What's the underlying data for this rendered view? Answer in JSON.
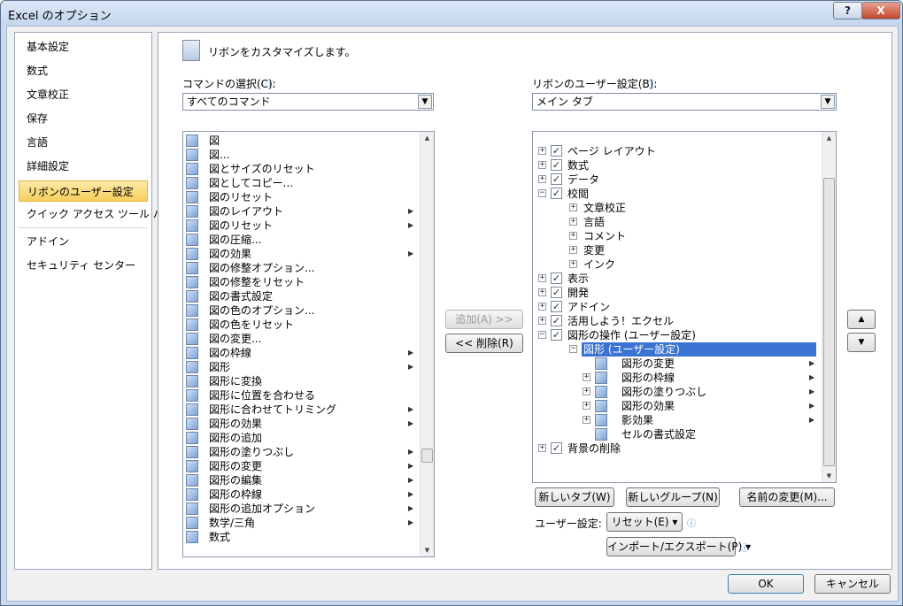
{
  "window": {
    "title": "Excel のオプション",
    "help": "?",
    "close": "X"
  },
  "nav": {
    "items": [
      "基本設定",
      "数式",
      "文章校正",
      "保存",
      "言語",
      "詳細設定",
      "リボンのユーザー設定",
      "クイック アクセス ツール バー",
      "アドイン",
      "セキュリティ センター"
    ],
    "selected_index": 6
  },
  "main": {
    "heading": "リボンをカスタマイズします。",
    "commands_label": "コマンドの選択(C):",
    "commands_value": "すべてのコマンド",
    "ribbon_label": "リボンのユーザー設定(B):",
    "ribbon_value": "メイン タブ",
    "add_button": "追加(A) >>",
    "remove_button": "<< 削除(R)",
    "new_tab": "新しいタブ(W)",
    "new_group": "新しいグループ(N)",
    "rename": "名前の変更(M)...",
    "user_settings_label": "ユーザー設定:",
    "reset": "リセット(E) ▾",
    "import_export": "インポート/エクスポート(P) ▾"
  },
  "command_list": [
    {
      "label": "図",
      "arrow": false
    },
    {
      "label": "図...",
      "arrow": false
    },
    {
      "label": "図とサイズのリセット",
      "arrow": false
    },
    {
      "label": "図としてコピー...",
      "arrow": false
    },
    {
      "label": "図のリセット",
      "arrow": false
    },
    {
      "label": "図のレイアウト",
      "arrow": true
    },
    {
      "label": "図のリセット",
      "arrow": true
    },
    {
      "label": "図の圧縮...",
      "arrow": false
    },
    {
      "label": "図の効果",
      "arrow": true
    },
    {
      "label": "図の修整オプション...",
      "arrow": false
    },
    {
      "label": "図の修整をリセット",
      "arrow": false
    },
    {
      "label": "図の書式設定",
      "arrow": false
    },
    {
      "label": "図の色のオプション...",
      "arrow": false
    },
    {
      "label": "図の色をリセット",
      "arrow": false
    },
    {
      "label": "図の変更...",
      "arrow": false
    },
    {
      "label": "図の枠線",
      "arrow": true
    },
    {
      "label": "図形",
      "arrow": true
    },
    {
      "label": "図形に変換",
      "arrow": false
    },
    {
      "label": "図形に位置を合わせる",
      "arrow": false
    },
    {
      "label": "図形に合わせてトリミング",
      "arrow": true
    },
    {
      "label": "図形の効果",
      "arrow": true
    },
    {
      "label": "図形の追加",
      "arrow": false
    },
    {
      "label": "図形の塗りつぶし",
      "arrow": true
    },
    {
      "label": "図形の変更",
      "arrow": true
    },
    {
      "label": "図形の編集",
      "arrow": true
    },
    {
      "label": "図形の枠線",
      "arrow": true
    },
    {
      "label": "図形の追加オプション",
      "arrow": true
    },
    {
      "label": "数学/三角",
      "arrow": true
    },
    {
      "label": "数式",
      "arrow": false
    }
  ],
  "ribbon_tree": [
    {
      "label": "ページ レイアウト",
      "level": 0,
      "expander": "+",
      "checkbox": true
    },
    {
      "label": "数式",
      "level": 0,
      "expander": "+",
      "checkbox": true
    },
    {
      "label": "データ",
      "level": 0,
      "expander": "+",
      "checkbox": true
    },
    {
      "label": "校閲",
      "level": 0,
      "expander": "−",
      "checkbox": true
    },
    {
      "label": "文章校正",
      "level": 1,
      "expander": "+",
      "checkbox": false
    },
    {
      "label": "言語",
      "level": 1,
      "expander": "+",
      "checkbox": false
    },
    {
      "label": "コメント",
      "level": 1,
      "expander": "+",
      "checkbox": false
    },
    {
      "label": "変更",
      "level": 1,
      "expander": "+",
      "checkbox": false
    },
    {
      "label": "インク",
      "level": 1,
      "expander": "+",
      "checkbox": false
    },
    {
      "label": "表示",
      "level": 0,
      "expander": "+",
      "checkbox": true
    },
    {
      "label": "開発",
      "level": 0,
      "expander": "+",
      "checkbox": true
    },
    {
      "label": "アドイン",
      "level": 0,
      "expander": "+",
      "checkbox": true
    },
    {
      "label": "活用しよう！エクセル",
      "level": 0,
      "expander": "+",
      "checkbox": true
    },
    {
      "label": "図形の操作 (ユーザー設定)",
      "level": 0,
      "expander": "−",
      "checkbox": true
    },
    {
      "label": "図形 (ユーザー設定)",
      "level": 1,
      "expander": "−",
      "checkbox": false,
      "selected": true
    },
    {
      "label": "図形の変更",
      "level": 2,
      "expander": "",
      "checkbox": false,
      "arrow": true
    },
    {
      "label": "図形の枠線",
      "level": 2,
      "expander": "+",
      "checkbox": false,
      "arrow": true
    },
    {
      "label": "図形の塗りつぶし",
      "level": 2,
      "expander": "+",
      "checkbox": false,
      "arrow": true
    },
    {
      "label": "図形の効果",
      "level": 2,
      "expander": "+",
      "checkbox": false,
      "arrow": true
    },
    {
      "label": "影効果",
      "level": 2,
      "expander": "+",
      "checkbox": false,
      "arrow": true
    },
    {
      "label": "セルの書式設定",
      "level": 2,
      "expander": "",
      "checkbox": false
    },
    {
      "label": "背景の削除",
      "level": 0,
      "expander": "+",
      "checkbox": true
    }
  ],
  "footer": {
    "ok": "OK",
    "cancel": "キャンセル"
  }
}
